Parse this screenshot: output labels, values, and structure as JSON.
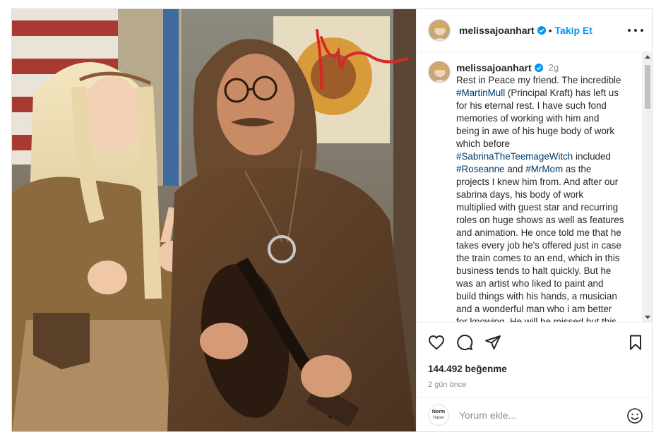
{
  "post": {
    "username": "melissajoanhart",
    "follow_label": "Takip Et",
    "dot": "•",
    "caption": {
      "time_ago": "2g",
      "text_lines": [
        {
          "t": "Rest in Peace my friend. The incredible",
          "tag": false
        },
        {
          "t": "#MartinMull",
          "tag": true,
          "after": " (Principal Kraft) has left us"
        },
        {
          "t": "for his eternal rest. I have such fond",
          "tag": false
        },
        {
          "t": "memories of working with him and",
          "tag": false
        },
        {
          "t": "being in awe of his huge body of work",
          "tag": false
        },
        {
          "t": "which before",
          "tag": false
        },
        {
          "t": "#SabrinaTheTeemageWitch",
          "tag": true,
          "after": " included"
        },
        {
          "t": "#Roseanne",
          "tag": true,
          "after": " and ",
          "t2": "#MrMom",
          "after2": " as the"
        },
        {
          "t": "projects I knew him from. And after our",
          "tag": false
        },
        {
          "t": "sabrina days, his body of work",
          "tag": false
        },
        {
          "t": "multiplied with guest star and recurring",
          "tag": false
        },
        {
          "t": "roles on huge shows as well as features",
          "tag": false
        },
        {
          "t": "and animation. He once told me that he",
          "tag": false
        },
        {
          "t": "takes every job he's offered just in case",
          "tag": false
        },
        {
          "t": "the train comes to an end, which in this",
          "tag": false
        },
        {
          "t": "business tends to halt quickly. But he",
          "tag": false
        },
        {
          "t": "was an artist who liked to paint and",
          "tag": false
        },
        {
          "t": "build things with his hands, a musician",
          "tag": false
        },
        {
          "t": "and a wonderful man who i am better",
          "tag": false
        },
        {
          "t": "for knowing. He will be missed but this",
          "tag": false
        }
      ]
    },
    "likes_label": "144.492 beğenme",
    "date_label": "2 gün önce",
    "comment_placeholder": "Yorum ekle...",
    "commenter_logo": {
      "line1": "Norm",
      "line2": "Haber"
    }
  },
  "icons": {
    "avatar": "profile-photo",
    "verified": "verified-badge-icon",
    "more": "more-options-icon",
    "like": "heart-icon",
    "comment": "comment-bubble-icon",
    "share": "send-paper-plane-icon",
    "save": "bookmark-icon",
    "emoji": "smiley-icon"
  },
  "colors": {
    "accent": "#0095f6",
    "hashtag": "#00376b",
    "muted": "#8e8e8e",
    "text": "#262626",
    "signature": "#d62828"
  }
}
